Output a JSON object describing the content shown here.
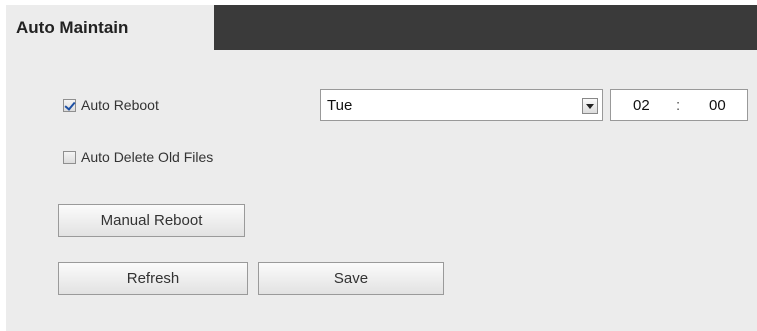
{
  "tab": {
    "title": "Auto Maintain"
  },
  "auto_reboot": {
    "label": "Auto Reboot",
    "checked": true
  },
  "auto_delete": {
    "label": "Auto Delete Old Files",
    "checked": false
  },
  "day_select": {
    "value": "Tue"
  },
  "time": {
    "hour": "02",
    "separator": ":",
    "minute": "00"
  },
  "buttons": {
    "manual_reboot": "Manual Reboot",
    "refresh": "Refresh",
    "save": "Save"
  },
  "colors": {
    "tabbar": "#3a3a3a",
    "panel": "#ececec",
    "check": "#1c4fa3"
  }
}
